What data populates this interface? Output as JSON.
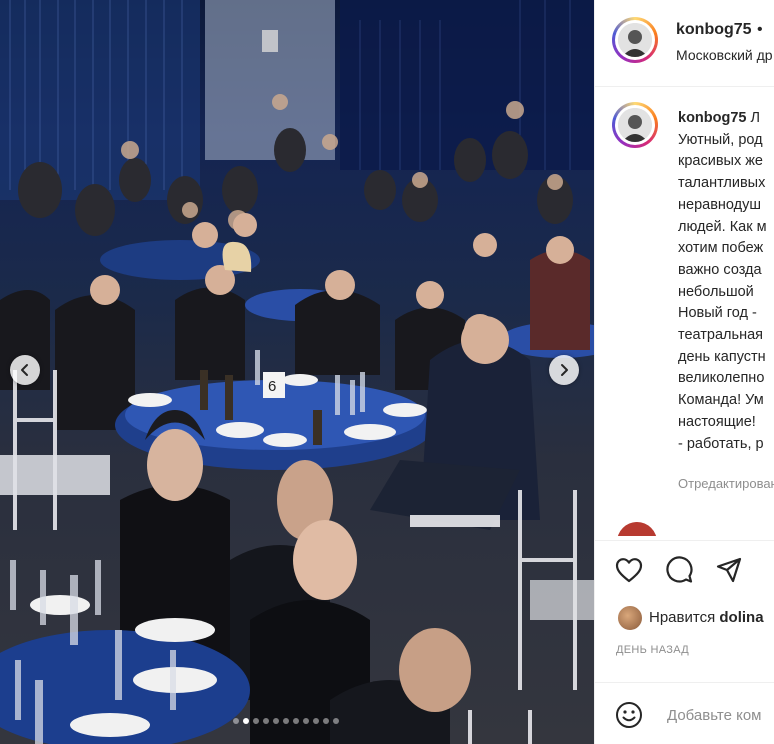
{
  "header": {
    "username": "konbog75",
    "separator": "•",
    "location": "Московский др"
  },
  "caption": {
    "username": "konbog75",
    "lines": [
      "Л",
      "Уютный, род",
      "красивых же",
      "талантливых",
      "неравнодуш",
      "людей. Как м",
      "хотим побеж",
      "важно созда",
      "небольшой",
      "Новый год -",
      "театральная",
      "день капустн",
      "великолепно",
      "Команда! Ум",
      "настоящие!",
      "- работать, р"
    ],
    "edited": "Отредактирован"
  },
  "actions": {
    "like_icon": "heart-icon",
    "comment_icon": "comment-icon",
    "share_icon": "share-icon"
  },
  "likes": {
    "prefix": "Нравится",
    "user": "dolina"
  },
  "timestamp": "ДЕНЬ НАЗАД",
  "comment": {
    "placeholder": "Добавьте ком",
    "emoji_icon": "smiley-icon"
  },
  "carousel": {
    "slide_count": 11,
    "active_index": 1,
    "prev_icon": "chevron-left-icon",
    "next_icon": "chevron-right-icon"
  },
  "photo": {
    "table_number": "6"
  },
  "colors": {
    "text": "#262626",
    "muted": "#8e8e8e",
    "border": "#efefef"
  }
}
